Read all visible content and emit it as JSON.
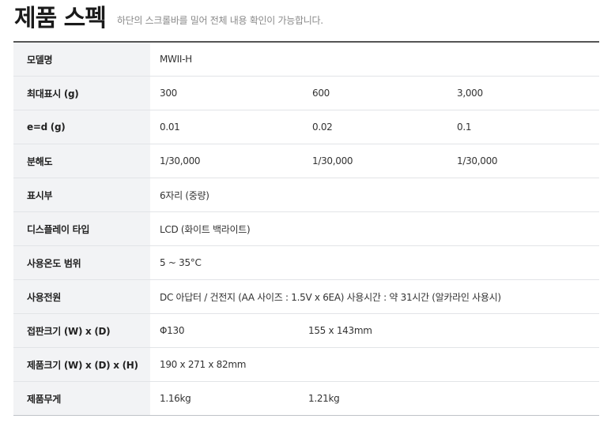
{
  "header": {
    "title": "제품 스펙",
    "subtitle": "하단의 스크롤바를 밀어 전체 내용 확인이 가능합니다."
  },
  "spec_rows": [
    {
      "label": "모델명",
      "values": [
        "MWII-H"
      ]
    },
    {
      "label": "최대표시 (g)",
      "values": [
        "300",
        "600",
        "3,000"
      ]
    },
    {
      "label": "e=d (g)",
      "values": [
        "0.01",
        "0.02",
        "0.1"
      ]
    },
    {
      "label": "분해도",
      "values": [
        "1/30,000",
        "1/30,000",
        "1/30,000"
      ]
    },
    {
      "label": "표시부",
      "values": [
        "6자리 (중량)"
      ]
    },
    {
      "label": "디스플레이 타입",
      "values": [
        "LCD (화이트 백라이트)"
      ]
    },
    {
      "label": "사용온도 범위",
      "values": [
        "5 ~ 35°C"
      ]
    },
    {
      "label": "사용전원",
      "values": [
        "DC 아답터 / 건전지 (AA 사이즈 : 1.5V x 6EA) 사용시간 : 약 31시간 (알카라인 사용시)"
      ]
    },
    {
      "label": "접판크기 (W) x (D)",
      "values": [
        "Φ130",
        "155 x 143mm"
      ]
    },
    {
      "label": "제품크기 (W) x (D) x (H)",
      "values": [
        "190 x 271 x 82mm"
      ]
    },
    {
      "label": "제품무게",
      "values": [
        "1.16kg",
        "1.21kg"
      ]
    }
  ]
}
